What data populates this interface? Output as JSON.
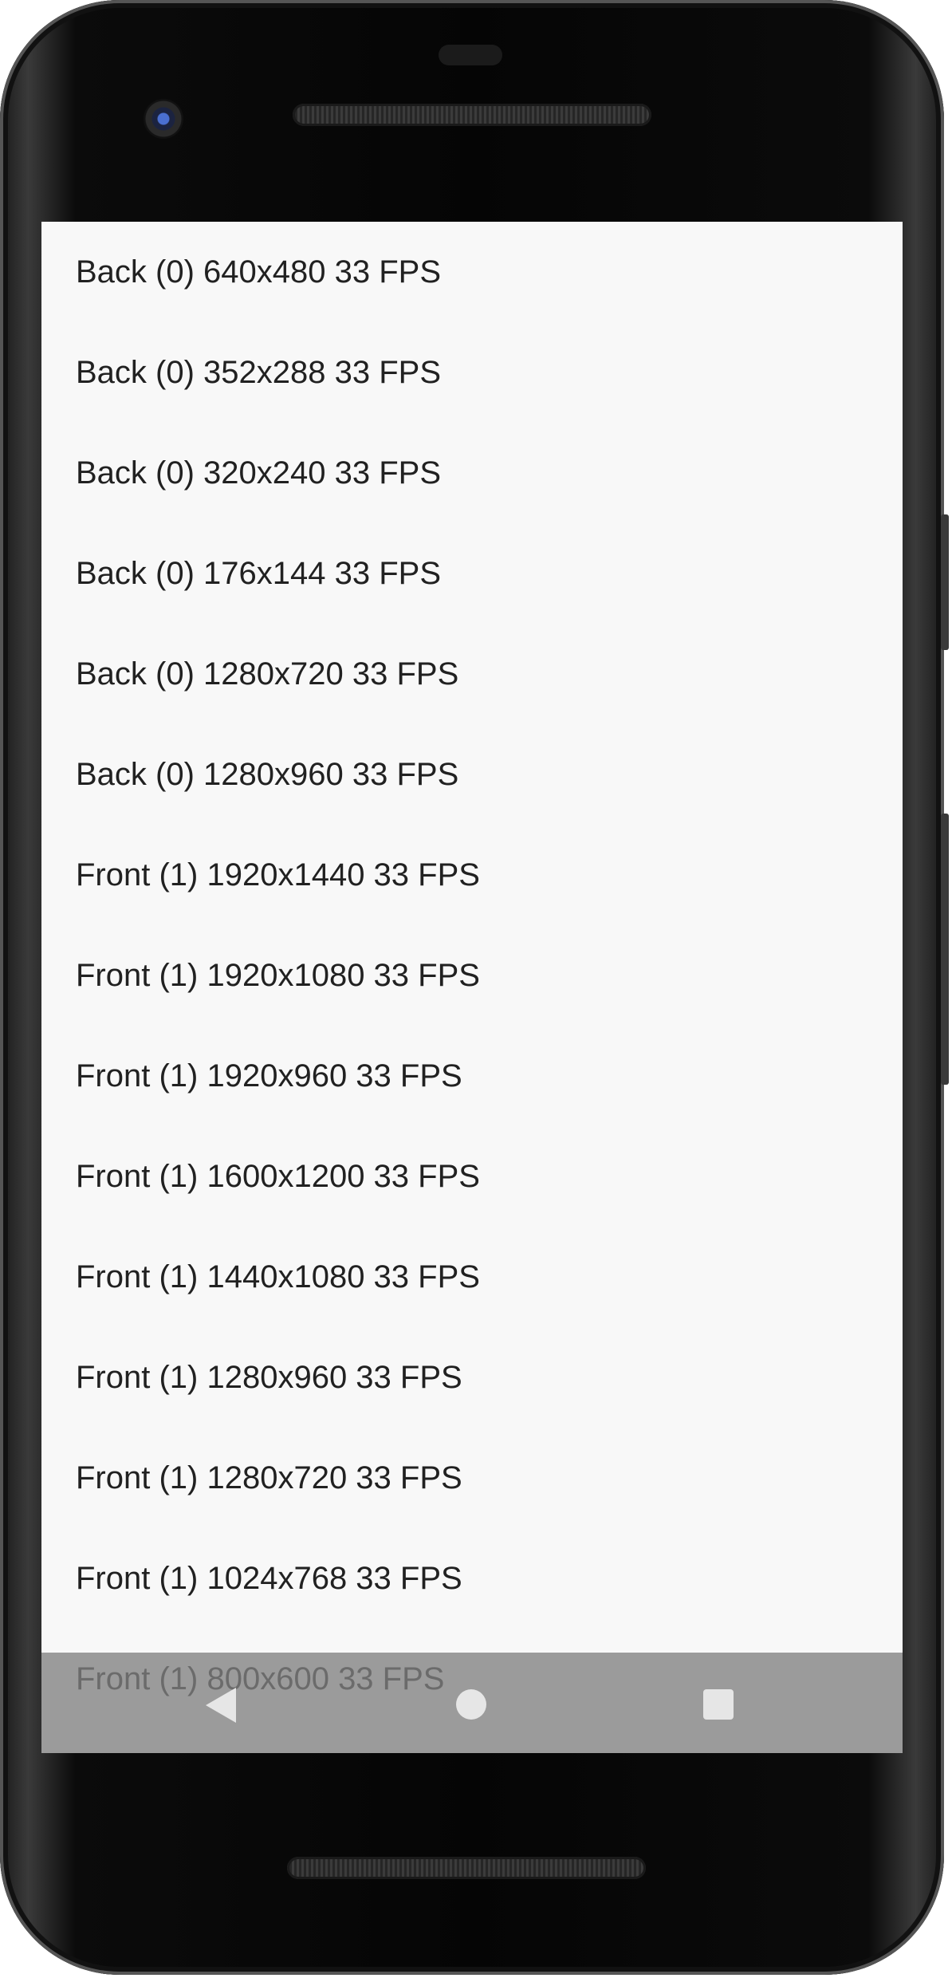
{
  "camera_list": {
    "items": [
      "Back (0) 640x480 33 FPS",
      "Back (0) 352x288 33 FPS",
      "Back (0) 320x240 33 FPS",
      "Back (0) 176x144 33 FPS",
      "Back (0) 1280x720 33 FPS",
      "Back (0) 1280x960 33 FPS",
      "Front (1) 1920x1440 33 FPS",
      "Front (1) 1920x1080 33 FPS",
      "Front (1) 1920x960 33 FPS",
      "Front (1) 1600x1200 33 FPS",
      "Front (1) 1440x1080 33 FPS",
      "Front (1) 1280x960 33 FPS",
      "Front (1) 1280x720 33 FPS",
      "Front (1) 1024x768 33 FPS",
      "Front (1) 800x600 33 FPS"
    ]
  },
  "nav_bar": {
    "back_icon": "back-triangle-icon",
    "home_icon": "home-circle-icon",
    "recents_icon": "recents-square-icon"
  },
  "colors": {
    "list_background": "#f8f8f8",
    "text": "#212121",
    "nav_bar": "#808080"
  }
}
